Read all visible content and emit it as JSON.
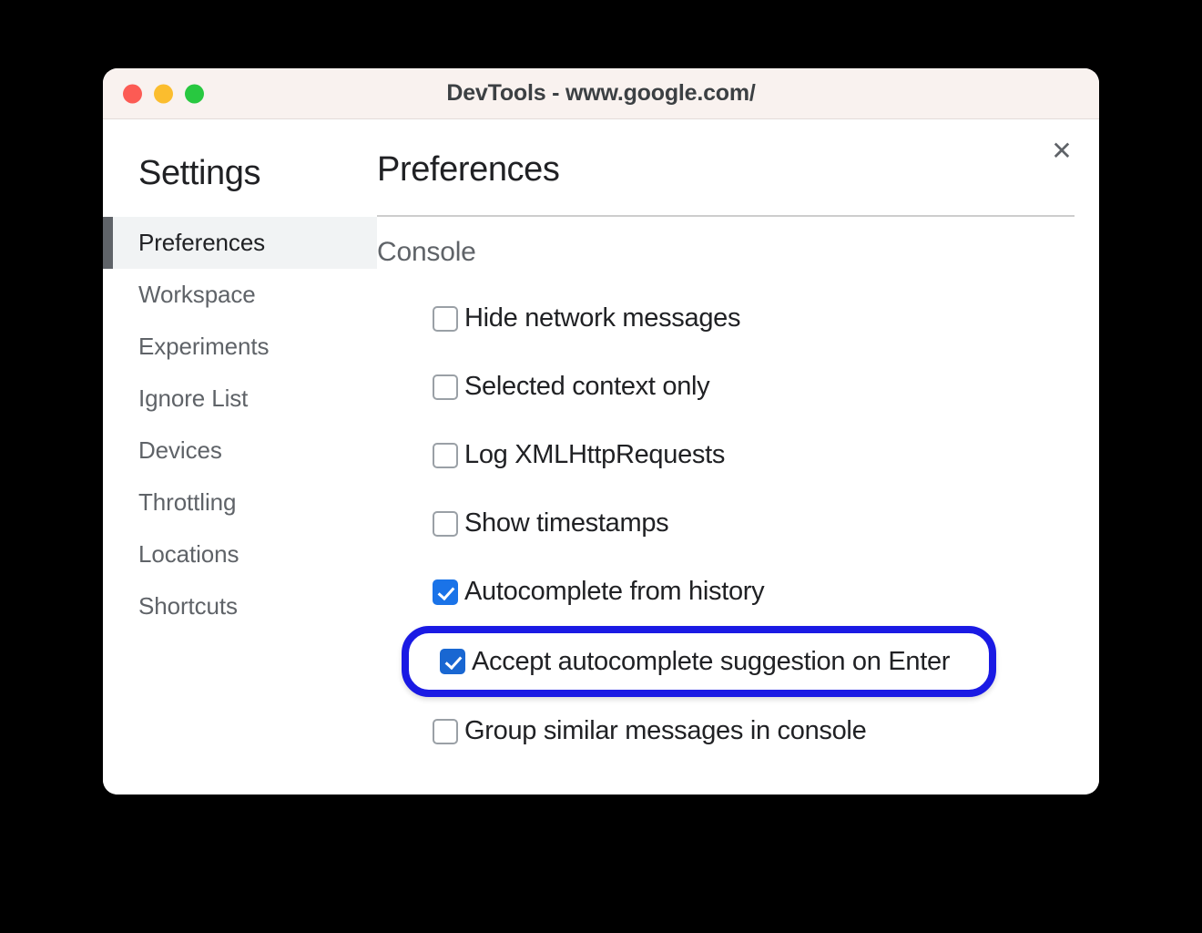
{
  "window": {
    "title": "DevTools - www.google.com/",
    "traffic_lights": [
      {
        "name": "close",
        "color": "#fc5b54"
      },
      {
        "name": "minimize",
        "color": "#fbbd2e"
      },
      {
        "name": "zoom",
        "color": "#28c840"
      }
    ],
    "close_icon": "✕"
  },
  "sidebar": {
    "heading": "Settings",
    "items": [
      {
        "label": "Preferences",
        "selected": true
      },
      {
        "label": "Workspace",
        "selected": false
      },
      {
        "label": "Experiments",
        "selected": false
      },
      {
        "label": "Ignore List",
        "selected": false
      },
      {
        "label": "Devices",
        "selected": false
      },
      {
        "label": "Throttling",
        "selected": false
      },
      {
        "label": "Locations",
        "selected": false
      },
      {
        "label": "Shortcuts",
        "selected": false
      }
    ]
  },
  "main": {
    "title": "Preferences",
    "section": "Console",
    "options": [
      {
        "label": "Hide network messages",
        "checked": false,
        "highlighted": false
      },
      {
        "label": "Selected context only",
        "checked": false,
        "highlighted": false
      },
      {
        "label": "Log XMLHttpRequests",
        "checked": false,
        "highlighted": false
      },
      {
        "label": "Show timestamps",
        "checked": false,
        "highlighted": false
      },
      {
        "label": "Autocomplete from history",
        "checked": true,
        "highlighted": false
      },
      {
        "label": "Accept autocomplete suggestion on Enter",
        "checked": true,
        "highlighted": true
      },
      {
        "label": "Group similar messages in console",
        "checked": false,
        "highlighted": false
      }
    ]
  },
  "colors": {
    "accent_checkbox": "#1a73e8",
    "accent_checkbox_dark": "#1967d2",
    "highlight_ring": "#1a1ae4",
    "selected_nav_bg": "#f1f3f4",
    "selected_nav_bar": "#5f6368",
    "titlebar_bg": "#f9f2ef",
    "text_primary": "#202124",
    "text_secondary": "#5f6368",
    "backdrop": "#000000"
  }
}
